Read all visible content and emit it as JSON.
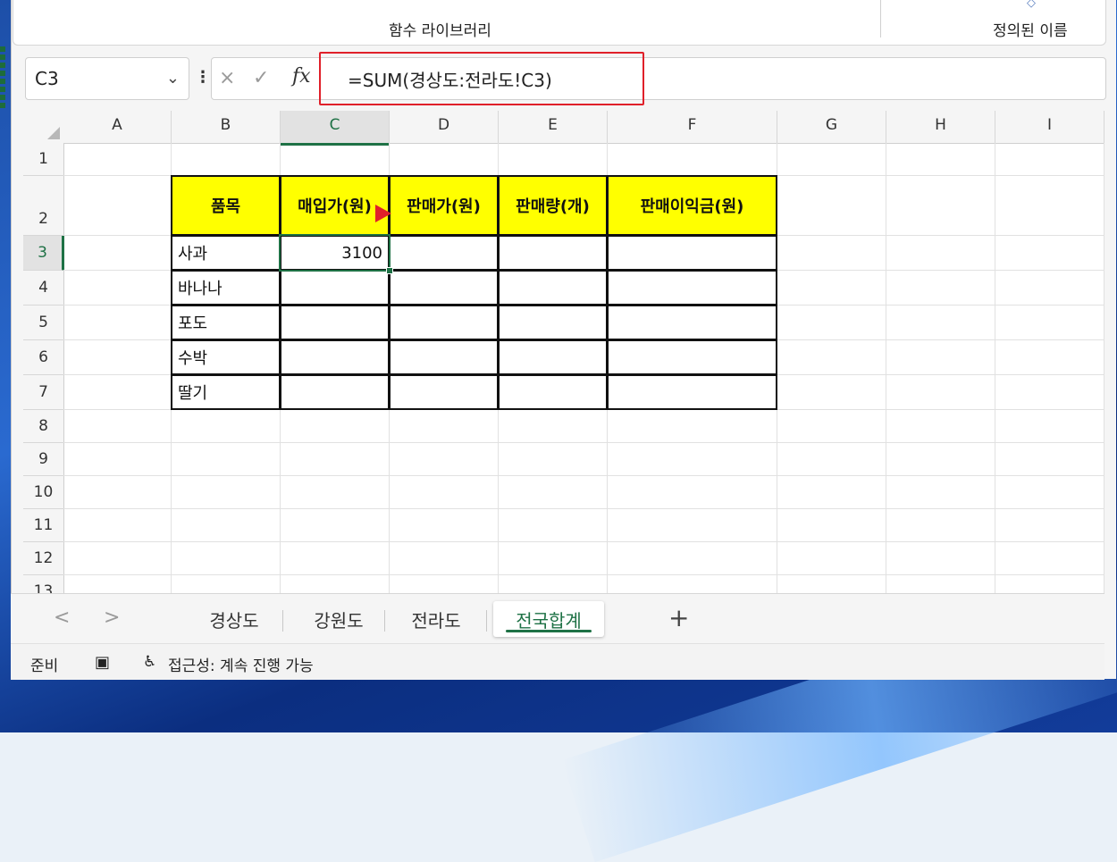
{
  "ribbon": {
    "group_function_library": "함수 라이브러리",
    "group_defined_names": "정의된 이름"
  },
  "formula_bar": {
    "name_box": "C3",
    "cancel_icon": "×",
    "enter_icon": "✓",
    "fx_label": "fx",
    "formula": "=SUM(경상도:전라도!C3)"
  },
  "columns": [
    "A",
    "B",
    "C",
    "D",
    "E",
    "F",
    "G",
    "H",
    "I"
  ],
  "rows": [
    "1",
    "2",
    "3",
    "4",
    "5",
    "6",
    "7",
    "8",
    "9",
    "10",
    "11",
    "12",
    "13"
  ],
  "active_cell": "C3",
  "table": {
    "headers": [
      "품목",
      "매입가(원)",
      "판매가(원)",
      "판매량(개)",
      "판매이익금(원)"
    ],
    "items": [
      "사과",
      "바나나",
      "포도",
      "수박",
      "딸기"
    ],
    "c3_value": "3100",
    "header_fill": "#ffff00"
  },
  "sheet_tabs": {
    "tabs": [
      "경상도",
      "강원도",
      "전라도",
      "전국합계"
    ],
    "active": "전국합계",
    "add_label": "+",
    "prev_label": "<",
    "next_label": ">"
  },
  "status_bar": {
    "ready": "준비",
    "accessibility": "접근성: 계속 진행 가능"
  },
  "colors": {
    "accent_green": "#1e7145",
    "annotation_red": "#e0202a"
  }
}
